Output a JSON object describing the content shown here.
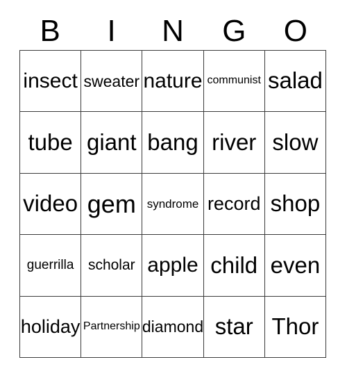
{
  "card": {
    "title": "BINGO",
    "header_letters": [
      "B",
      "I",
      "N",
      "G",
      "O"
    ],
    "border_color": "#3a3a3a",
    "background_color": "#ffffff",
    "text_color": "#000000",
    "rows": [
      [
        {
          "label": "insect",
          "size": "fs-l"
        },
        {
          "label": "sweater",
          "size": "fs-m"
        },
        {
          "label": "nature",
          "size": "fs-l"
        },
        {
          "label": "communist",
          "size": "fs-xs"
        },
        {
          "label": "salad",
          "size": "fs-xl"
        }
      ],
      [
        {
          "label": "tube",
          "size": "fs-xl"
        },
        {
          "label": "giant",
          "size": "fs-xl"
        },
        {
          "label": "bang",
          "size": "fs-xl"
        },
        {
          "label": "river",
          "size": "fs-xl"
        },
        {
          "label": "slow",
          "size": "fs-xl"
        }
      ],
      [
        {
          "label": "video",
          "size": "fs-xl"
        },
        {
          "label": "gem",
          "size": "fs-xxl"
        },
        {
          "label": "syndrome",
          "size": "fs-sm"
        },
        {
          "label": "record",
          "size": "fs-ml"
        },
        {
          "label": "shop",
          "size": "fs-xl"
        }
      ],
      [
        {
          "label": "guerrilla",
          "size": "fs-s"
        },
        {
          "label": "scholar",
          "size": "fs-ms"
        },
        {
          "label": "apple",
          "size": "fs-l"
        },
        {
          "label": "child",
          "size": "fs-xl"
        },
        {
          "label": "even",
          "size": "fs-xl"
        }
      ],
      [
        {
          "label": "holiday",
          "size": "fs-ml"
        },
        {
          "label": "Partnership",
          "size": "fs-xs"
        },
        {
          "label": "diamond",
          "size": "fs-m"
        },
        {
          "label": "star",
          "size": "fs-xl"
        },
        {
          "label": "Thor",
          "size": "fs-xl"
        }
      ]
    ]
  }
}
